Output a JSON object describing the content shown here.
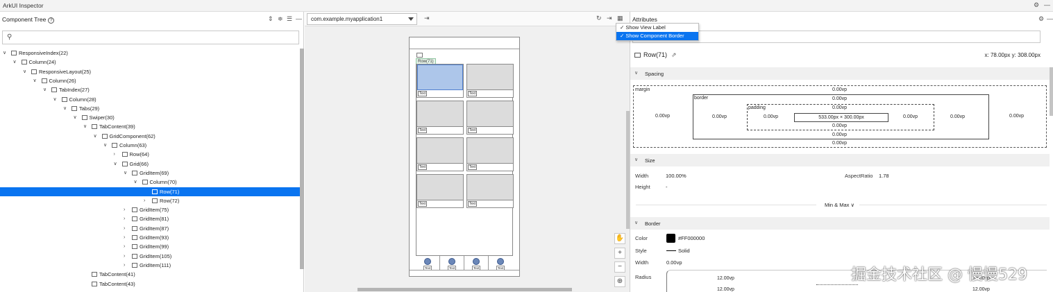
{
  "app": {
    "title": "ArkUI Inspector"
  },
  "left": {
    "title": "Component Tree",
    "tree": [
      {
        "label": "ResponsiveIndex(22)",
        "depth": 0,
        "chev": "v"
      },
      {
        "label": "Column(24)",
        "depth": 1,
        "chev": "v"
      },
      {
        "label": "ResponsiveLayout(25)",
        "depth": 2,
        "chev": "v"
      },
      {
        "label": "Column(26)",
        "depth": 3,
        "chev": "v"
      },
      {
        "label": "TabIndex(27)",
        "depth": 4,
        "chev": "v"
      },
      {
        "label": "Column(28)",
        "depth": 5,
        "chev": "v"
      },
      {
        "label": "Tabs(29)",
        "depth": 6,
        "chev": "v"
      },
      {
        "label": "Swiper(30)",
        "depth": 7,
        "chev": "v"
      },
      {
        "label": "TabContent(39)",
        "depth": 8,
        "chev": "v"
      },
      {
        "label": "GridComponent(62)",
        "depth": 9,
        "chev": "v"
      },
      {
        "label": "Column(63)",
        "depth": 10,
        "chev": "v"
      },
      {
        "label": "Row(64)",
        "depth": 11,
        "chev": ">"
      },
      {
        "label": "Grid(66)",
        "depth": 11,
        "chev": "v"
      },
      {
        "label": "GridItem(69)",
        "depth": 12,
        "chev": "v"
      },
      {
        "label": "Column(70)",
        "depth": 13,
        "chev": "v"
      },
      {
        "label": "Row(71)",
        "depth": 14,
        "chev": "",
        "selected": true
      },
      {
        "label": "Row(72)",
        "depth": 14,
        "chev": ">"
      },
      {
        "label": "GridItem(75)",
        "depth": 12,
        "chev": ">"
      },
      {
        "label": "GridItem(81)",
        "depth": 12,
        "chev": ">"
      },
      {
        "label": "GridItem(87)",
        "depth": 12,
        "chev": ">"
      },
      {
        "label": "GridItem(93)",
        "depth": 12,
        "chev": ">"
      },
      {
        "label": "GridItem(99)",
        "depth": 12,
        "chev": ">"
      },
      {
        "label": "GridItem(105)",
        "depth": 12,
        "chev": ">"
      },
      {
        "label": "GridItem(111)",
        "depth": 12,
        "chev": ">"
      },
      {
        "label": "TabContent(41)",
        "depth": 8,
        "chev": ""
      },
      {
        "label": "TabContent(43)",
        "depth": 8,
        "chev": ""
      }
    ]
  },
  "mid": {
    "device": "com.example.myapplication1",
    "row_tag": "Row(71)",
    "cell_label": "Text",
    "tab_label": "Text"
  },
  "popup": {
    "items": [
      {
        "label": "Show View Label",
        "check": "✓"
      },
      {
        "label": "Show Component Border",
        "check": "✓"
      }
    ]
  },
  "right": {
    "title": "Attributes",
    "component": "Row(71)",
    "coords": "x: 78.00px  y: 308.00px",
    "spacing": {
      "title": "Spacing",
      "margin_label": "margin",
      "border_label": "border",
      "padding_label": "padding",
      "margin_top": "0.00vp",
      "margin_left": "0.00vp",
      "margin_right": "0.00vp",
      "margin_bottom": "0.00vp",
      "border_top": "0.00vp",
      "border_left": "0.00vp",
      "border_right": "0.00vp",
      "border_bottom": "0.00vp",
      "padding_top": "0.00vp",
      "padding_left": "0.00vp",
      "padding_right": "0.00vp",
      "padding_bottom": "0.00vp",
      "content": "533.00px × 300.00px"
    },
    "size": {
      "title": "Size",
      "width_label": "Width",
      "width": "100.00%",
      "height_label": "Height",
      "height": "-",
      "aspect_label": "AspectRatio",
      "aspect": "1.78",
      "minmax": "Min & Max"
    },
    "border": {
      "title": "Border",
      "color_label": "Color",
      "color": "#FF000000",
      "style_label": "Style",
      "style": "Solid",
      "width_label": "Width",
      "width": "0.00vp",
      "radius_label": "Radius",
      "radius_a": "12.00vp",
      "radius_b": "12.00vp",
      "radius_c": "12.00vp",
      "radius_d": "12.00vp"
    }
  },
  "watermark": "掘金技术社区 @ 慢慢529"
}
